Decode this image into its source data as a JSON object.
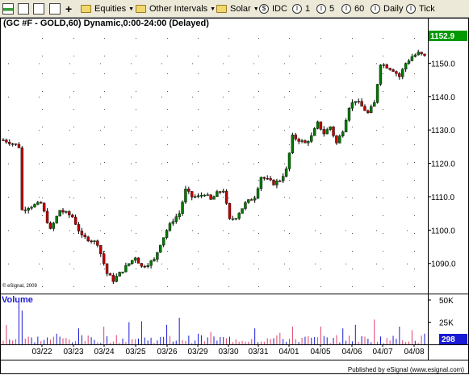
{
  "toolbar": {
    "items": [
      {
        "label": "Equities",
        "dropdown": true
      },
      {
        "label": "Other Intervals",
        "dropdown": true
      },
      {
        "label": "Solar",
        "dropdown": true
      },
      {
        "label": "IDC"
      },
      {
        "label": "1"
      },
      {
        "label": "5"
      },
      {
        "label": "60"
      },
      {
        "label": "Daily"
      },
      {
        "label": "Tick"
      }
    ]
  },
  "chart": {
    "title": "(GC #F - GOLD,60) Dynamic,0:00-24:00 (Delayed)",
    "copyright": "© eSignal, 2009",
    "last_price": "1152.9",
    "last_volume": "298",
    "volume_label": "Volume",
    "footer": "Published by eSignal (www.esignal.com)",
    "colors": {
      "up": "#007a00",
      "down": "#c00000",
      "vol_up": "#1a1ad4",
      "vol_down": "#e0406a",
      "last_box": "#009900",
      "vol_box": "#1a1ad4"
    }
  },
  "chart_data": {
    "type": "candlestick",
    "title": "(GC #F - GOLD,60) Dynamic,0:00-24:00 (Delayed)",
    "ylim": [
      1081,
      1160
    ],
    "yticks": [
      "1090.0",
      "1100.0",
      "1110.0",
      "1120.0",
      "1130.0",
      "1140.0",
      "1150.0"
    ],
    "xticks": [
      "03/22",
      "03/23",
      "03/24",
      "03/25",
      "03/26",
      "03/29",
      "03/30",
      "03/31",
      "04/01",
      "04/05",
      "04/06",
      "04/07",
      "04/08"
    ],
    "close_path": [
      [
        0,
        1127
      ],
      [
        3,
        1126
      ],
      [
        5,
        1125
      ],
      [
        6,
        1106
      ],
      [
        8,
        1107
      ],
      [
        12,
        1108
      ],
      [
        15,
        1100
      ],
      [
        18,
        1106
      ],
      [
        22,
        1104
      ],
      [
        25,
        1098
      ],
      [
        28,
        1097
      ],
      [
        30,
        1096
      ],
      [
        33,
        1087
      ],
      [
        35,
        1085
      ],
      [
        38,
        1088
      ],
      [
        40,
        1090
      ],
      [
        42,
        1092
      ],
      [
        44,
        1089
      ],
      [
        46,
        1090
      ],
      [
        48,
        1091
      ],
      [
        50,
        1096
      ],
      [
        52,
        1100
      ],
      [
        54,
        1103
      ],
      [
        56,
        1105
      ],
      [
        58,
        1112
      ],
      [
        60,
        1110
      ],
      [
        62,
        1110
      ],
      [
        64,
        1111
      ],
      [
        66,
        1109
      ],
      [
        68,
        1111
      ],
      [
        70,
        1112
      ],
      [
        72,
        1103
      ],
      [
        74,
        1104
      ],
      [
        77,
        1108
      ],
      [
        80,
        1110
      ],
      [
        82,
        1116
      ],
      [
        84,
        1115
      ],
      [
        86,
        1114
      ],
      [
        88,
        1115
      ],
      [
        90,
        1118
      ],
      [
        92,
        1128
      ],
      [
        94,
        1127
      ],
      [
        96,
        1126
      ],
      [
        98,
        1128
      ],
      [
        100,
        1132
      ],
      [
        102,
        1129
      ],
      [
        104,
        1131
      ],
      [
        106,
        1126
      ],
      [
        108,
        1130
      ],
      [
        110,
        1137
      ],
      [
        112,
        1139
      ],
      [
        114,
        1137
      ],
      [
        116,
        1135
      ],
      [
        118,
        1138
      ],
      [
        120,
        1150
      ],
      [
        122,
        1149
      ],
      [
        124,
        1148
      ],
      [
        126,
        1146
      ],
      [
        128,
        1150
      ],
      [
        130,
        1152
      ],
      [
        132,
        1153
      ],
      [
        134,
        1152
      ]
    ],
    "volume": {
      "ylim": [
        0,
        50000
      ],
      "yticks": [
        "50K",
        "25K"
      ],
      "spikes": [
        [
          1,
          22000,
          0
        ],
        [
          5,
          50000,
          1
        ],
        [
          6,
          38000,
          1
        ],
        [
          17,
          12000,
          1
        ],
        [
          24,
          18000,
          1
        ],
        [
          32,
          20000,
          0
        ],
        [
          40,
          25000,
          1
        ],
        [
          44,
          26000,
          1
        ],
        [
          52,
          22000,
          1
        ],
        [
          56,
          30000,
          1
        ],
        [
          62,
          12000,
          1
        ],
        [
          66,
          14000,
          0
        ],
        [
          80,
          18000,
          1
        ],
        [
          88,
          13000,
          0
        ],
        [
          92,
          20000,
          0
        ],
        [
          101,
          20000,
          0
        ],
        [
          108,
          18000,
          1
        ],
        [
          112,
          22000,
          1
        ],
        [
          118,
          28000,
          0
        ],
        [
          126,
          20000,
          1
        ],
        [
          130,
          16000,
          0
        ],
        [
          134,
          12000,
          1
        ]
      ]
    }
  }
}
